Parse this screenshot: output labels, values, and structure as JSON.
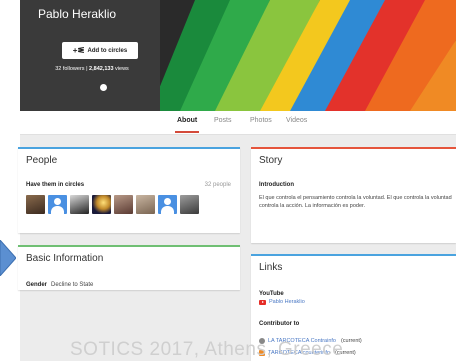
{
  "profile": {
    "name": "Pablo Heraklio",
    "add_button_label": "Add to circles",
    "followers": "32 followers",
    "separator": " | ",
    "views_count": "2,842,133",
    "views_label": " views"
  },
  "tabs": [
    {
      "label": "About",
      "active": true
    },
    {
      "label": "Posts",
      "active": false
    },
    {
      "label": "Photos",
      "active": false
    },
    {
      "label": "Videos",
      "active": false
    }
  ],
  "people": {
    "title": "People",
    "subtitle": "Have them in circles",
    "count": "32 people"
  },
  "basic": {
    "title": "Basic Information",
    "gender_label": "Gender",
    "gender_value": "Decline to State"
  },
  "story": {
    "title": "Story",
    "intro_label": "Introduction",
    "intro_text": "El que controla el pensamiento controla la voluntad. El que controla la voluntad controla la acción. La información es poder."
  },
  "links": {
    "title": "Links",
    "youtube_label": "YouTube",
    "youtube_item": "Pablo Heraklio",
    "contributor_label": "Contributor to",
    "contrib_1": "LA TARCOTECA Contrainfo",
    "contrib_1_status": "(current)",
    "contrib_2": "TARCOTECA counterinfo",
    "contrib_2_status": "(current)"
  },
  "footer_caption": "SOTICS 2017, Athens, Greece",
  "colors": {
    "people_accent": "#4aa3df",
    "basic_accent": "#6fbf73",
    "story_accent": "#e5553c",
    "tab_active_underline": "#d44a3a",
    "link_color": "#4a78c4"
  }
}
